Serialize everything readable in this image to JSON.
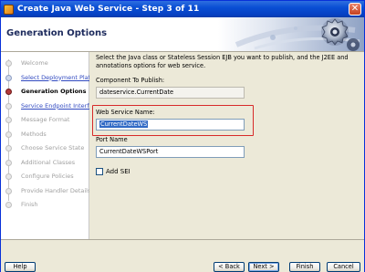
{
  "window": {
    "title": "Create Java Web Service - Step 3 of 11",
    "close_glyph": "✕"
  },
  "header": {
    "title": "Generation Options"
  },
  "nav": {
    "items": [
      {
        "label": "Welcome",
        "state": "disabled"
      },
      {
        "label": "Select Deployment Platfo",
        "state": "done"
      },
      {
        "label": "Generation Options",
        "state": "current"
      },
      {
        "label": "Service Endpoint Interfa",
        "state": "link"
      },
      {
        "label": "Message Format",
        "state": "disabled"
      },
      {
        "label": "Methods",
        "state": "disabled"
      },
      {
        "label": "Choose Service State",
        "state": "disabled"
      },
      {
        "label": "Additional Classes",
        "state": "disabled"
      },
      {
        "label": "Configure Policies",
        "state": "disabled"
      },
      {
        "label": "Provide Handler Details",
        "state": "disabled"
      },
      {
        "label": "Finish",
        "state": "disabled"
      }
    ]
  },
  "main": {
    "description": "Select the Java class or Stateless Session EJB you want to publish, and the J2EE and annotations options for web service.",
    "component_label": "Component To Publish:",
    "component_value": "dateservice.CurrentDate",
    "service_name_label": "Web Service Name:",
    "service_name_value": "CurrentDateWS",
    "port_label": "Port Name",
    "port_value": "CurrentDateWSPort",
    "add_sei_label": "Add SEI"
  },
  "footer": {
    "help": "Help",
    "back": "< Back",
    "next": "Next >",
    "finish": "Finish",
    "cancel": "Cancel"
  },
  "colors": {
    "accent": "#316ac5",
    "highlight_frame": "#d72a2a",
    "link": "#3049c0"
  }
}
